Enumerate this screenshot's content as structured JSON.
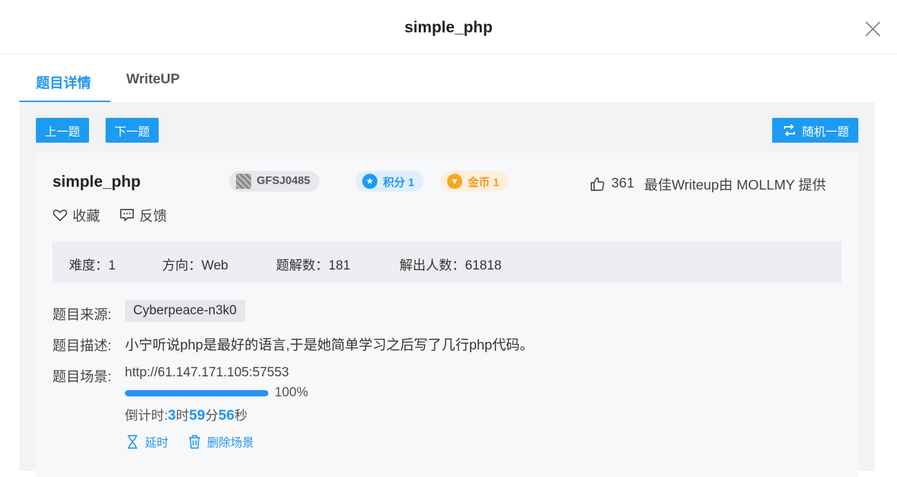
{
  "dialog": {
    "title": "simple_php"
  },
  "tabs": [
    {
      "label": "题目详情",
      "active": true
    },
    {
      "label": "WriteUP",
      "active": false
    }
  ],
  "toolbar": {
    "prev_label": "上一题",
    "next_label": "下一题",
    "random_label": "随机一题"
  },
  "challenge": {
    "title": "simple_php",
    "code": "GFSJ0485",
    "score_label": "积分 1",
    "coin_label": "金币 1",
    "likes": "361",
    "best_writeup": "最佳Writeup由 MOLLMY 提供",
    "favorite_label": "收藏",
    "feedback_label": "反馈"
  },
  "stats": {
    "difficulty": "难度：1",
    "direction": "方向：Web",
    "writeups": "题解数：181",
    "solvers": "解出人数：61818"
  },
  "details": {
    "source_label": "题目来源:",
    "source_value": "Cyberpeace-n3k0",
    "desc_label": "题目描述:",
    "desc_value": "小宁听说php是最好的语言,于是她简单学习之后写了几行php代码。",
    "scene_label": "题目场景:",
    "scene_url": "http://61.147.171.105:57553",
    "progress": 1.0,
    "progress_text": "100%",
    "countdown_prefix": "倒计时: ",
    "hours": "3",
    "hours_unit": "时",
    "minutes": "59",
    "minutes_unit": "分",
    "seconds": "56",
    "seconds_unit": "秒",
    "extend_label": "延时",
    "delete_label": "删除场景"
  },
  "colors": {
    "accent": "#1e9bf0",
    "coin": "#f39a1c",
    "panel_bg": "#f2f3f5"
  }
}
